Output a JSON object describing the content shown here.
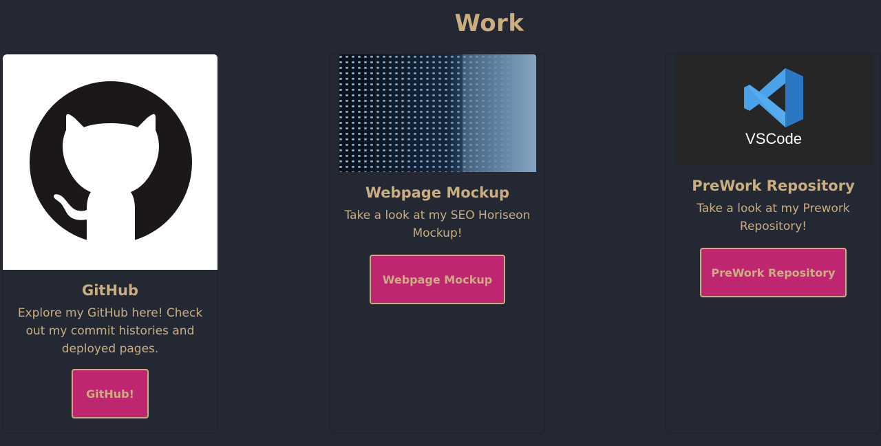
{
  "section": {
    "title": "Work"
  },
  "colors": {
    "background": "#242833",
    "accent_text": "#c9ae82",
    "button_bg": "#be276f"
  },
  "cards": [
    {
      "title": "GitHub",
      "text": "Explore my GitHub here! Check out my commit histories and deployed pages.",
      "button_label": "GitHub!",
      "image_icon": "github-octocat-icon"
    },
    {
      "title": "Webpage Mockup",
      "text": "Take a look at my SEO Horiseon Mockup!",
      "button_label": "Webpage Mockup",
      "image_icon": "led-wall-image"
    },
    {
      "title": "PreWork Repository",
      "text": "Take a look at my Prework Repository!",
      "button_label": "PreWork Repository",
      "image_icon": "vscode-logo-icon",
      "image_caption": "VSCode"
    }
  ]
}
